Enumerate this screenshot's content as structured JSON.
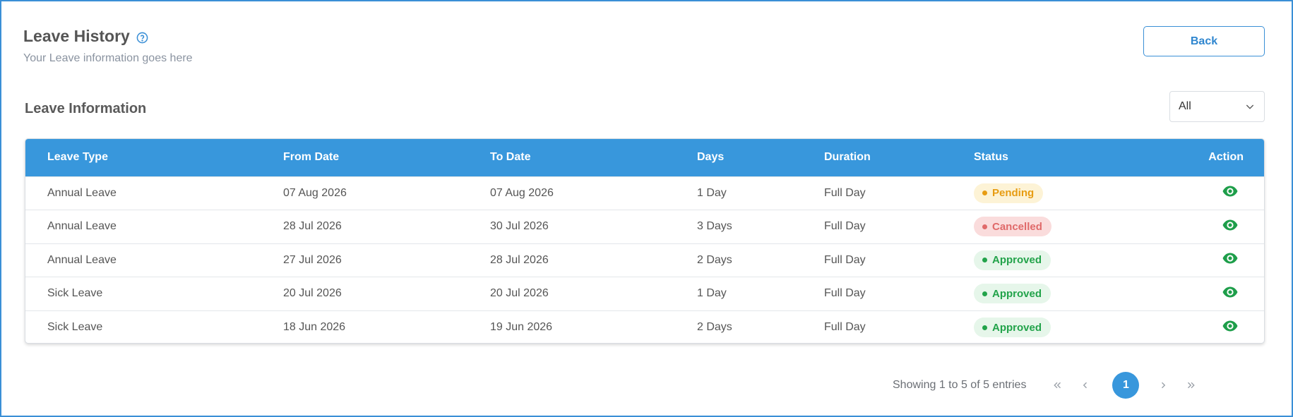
{
  "header": {
    "title": "Leave History",
    "subtitle": "Your Leave information goes here",
    "back_label": "Back"
  },
  "section": {
    "title": "Leave Information",
    "filter_value": "All"
  },
  "table": {
    "columns": [
      "Leave Type",
      "From Date",
      "To Date",
      "Days",
      "Duration",
      "Status",
      "Action"
    ],
    "rows": [
      {
        "type": "Annual Leave",
        "from": "07 Aug 2026",
        "to": "07 Aug 2026",
        "days": "1 Day",
        "duration": "Full Day",
        "status": "Pending",
        "status_kind": "pending"
      },
      {
        "type": "Annual Leave",
        "from": "28 Jul 2026",
        "to": "30 Jul 2026",
        "days": "3 Days",
        "duration": "Full Day",
        "status": "Cancelled",
        "status_kind": "cancelled"
      },
      {
        "type": "Annual Leave",
        "from": "27 Jul 2026",
        "to": "28 Jul 2026",
        "days": "2 Days",
        "duration": "Full Day",
        "status": "Approved",
        "status_kind": "approved"
      },
      {
        "type": "Sick Leave",
        "from": "20 Jul 2026",
        "to": "20 Jul 2026",
        "days": "1 Day",
        "duration": "Full Day",
        "status": "Approved",
        "status_kind": "approved"
      },
      {
        "type": "Sick Leave",
        "from": "18 Jun 2026",
        "to": "19 Jun 2026",
        "days": "2 Days",
        "duration": "Full Day",
        "status": "Approved",
        "status_kind": "approved"
      }
    ]
  },
  "pagination": {
    "summary": "Showing 1 to 5 of 5 entries",
    "current_page": "1"
  },
  "icons": {
    "help": "help-circle-icon",
    "filter": "chevron-down-icon",
    "action": "eye-icon",
    "first": "double-chevron-left-icon",
    "prev": "chevron-left-icon",
    "next": "chevron-right-icon",
    "last": "double-chevron-right-icon"
  },
  "colors": {
    "accent": "#3897dc",
    "pending": "#e79c12",
    "cancelled": "#e06a6a",
    "approved": "#22a34a"
  }
}
